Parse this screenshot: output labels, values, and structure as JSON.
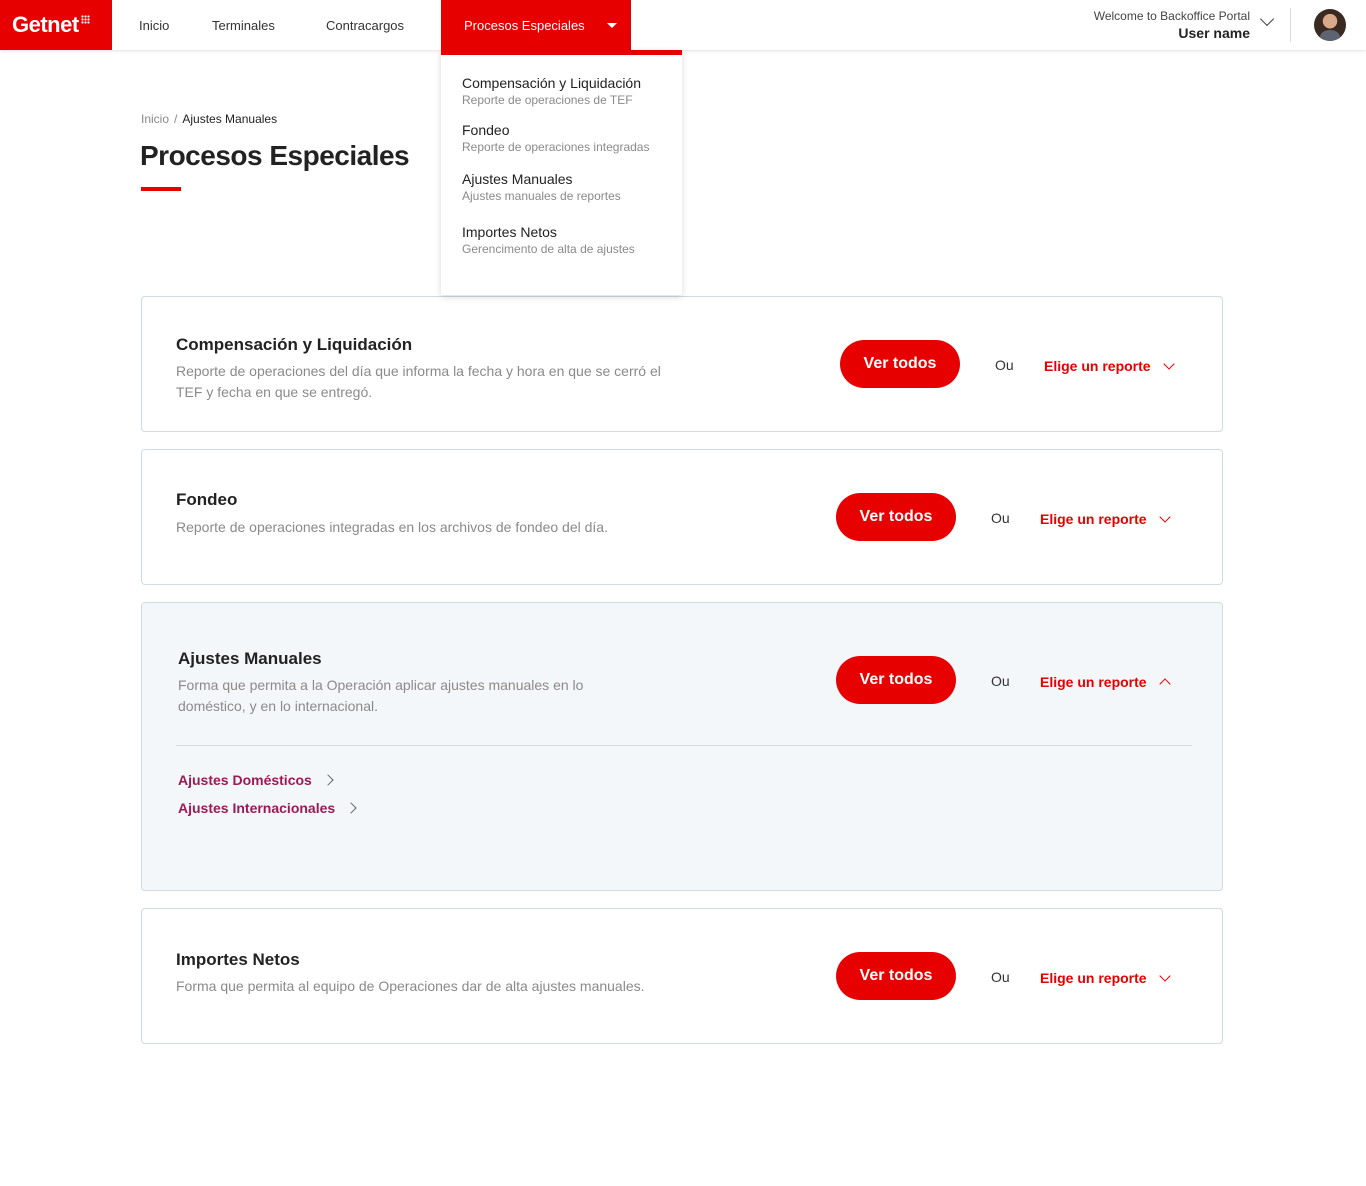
{
  "brand": {
    "name": "Getnet",
    "color": "#e60000"
  },
  "nav": {
    "items": [
      {
        "label": "Inicio"
      },
      {
        "label": "Terminales"
      },
      {
        "label": "Contracargos"
      },
      {
        "label": "Procesos Especiales",
        "active": true
      }
    ]
  },
  "user": {
    "welcome": "Welcome to Backoffice Portal",
    "name": "User name"
  },
  "dropdown": {
    "items": [
      {
        "title": "Compensación y Liquidación",
        "subtitle": "Reporte de operaciones de TEF"
      },
      {
        "title": "Fondeo",
        "subtitle": "Reporte de operaciones integradas"
      },
      {
        "title": "Ajustes Manuales",
        "subtitle": "Ajustes manuales de reportes"
      },
      {
        "title": "Importes Netos",
        "subtitle": "Gerencimento de alta de ajustes"
      }
    ]
  },
  "breadcrumb": {
    "home": "Inicio",
    "separator": "/",
    "current": "Ajustes Manuales"
  },
  "page": {
    "title": "Procesos Especiales"
  },
  "cards": [
    {
      "title": "Compensación y Liquidación",
      "description": "Reporte de operaciones del día que informa la fecha y hora en que se cerró el TEF y fecha en que se entregó.",
      "button": "Ver todos",
      "or": "Ou",
      "select": "Elige un reporte"
    },
    {
      "title": "Fondeo",
      "description": "Reporte de operaciones integradas en los archivos de fondeo del día.",
      "button": "Ver todos",
      "or": "Ou",
      "select": "Elige un reporte"
    },
    {
      "title": "Ajustes Manuales",
      "description": "Forma que permita a la Operación aplicar ajustes manuales en lo doméstico, y en lo internacional.",
      "button": "Ver todos",
      "or": "Ou",
      "select": "Elige un reporte",
      "links": [
        {
          "label": "Ajustes Domésticos"
        },
        {
          "label": "Ajustes Internacionales"
        }
      ]
    },
    {
      "title": "Importes Netos",
      "description": "Forma que permita al equipo de Operaciones dar de alta ajustes manuales.",
      "button": "Ver todos",
      "or": "Ou",
      "select": "Elige un reporte"
    }
  ]
}
